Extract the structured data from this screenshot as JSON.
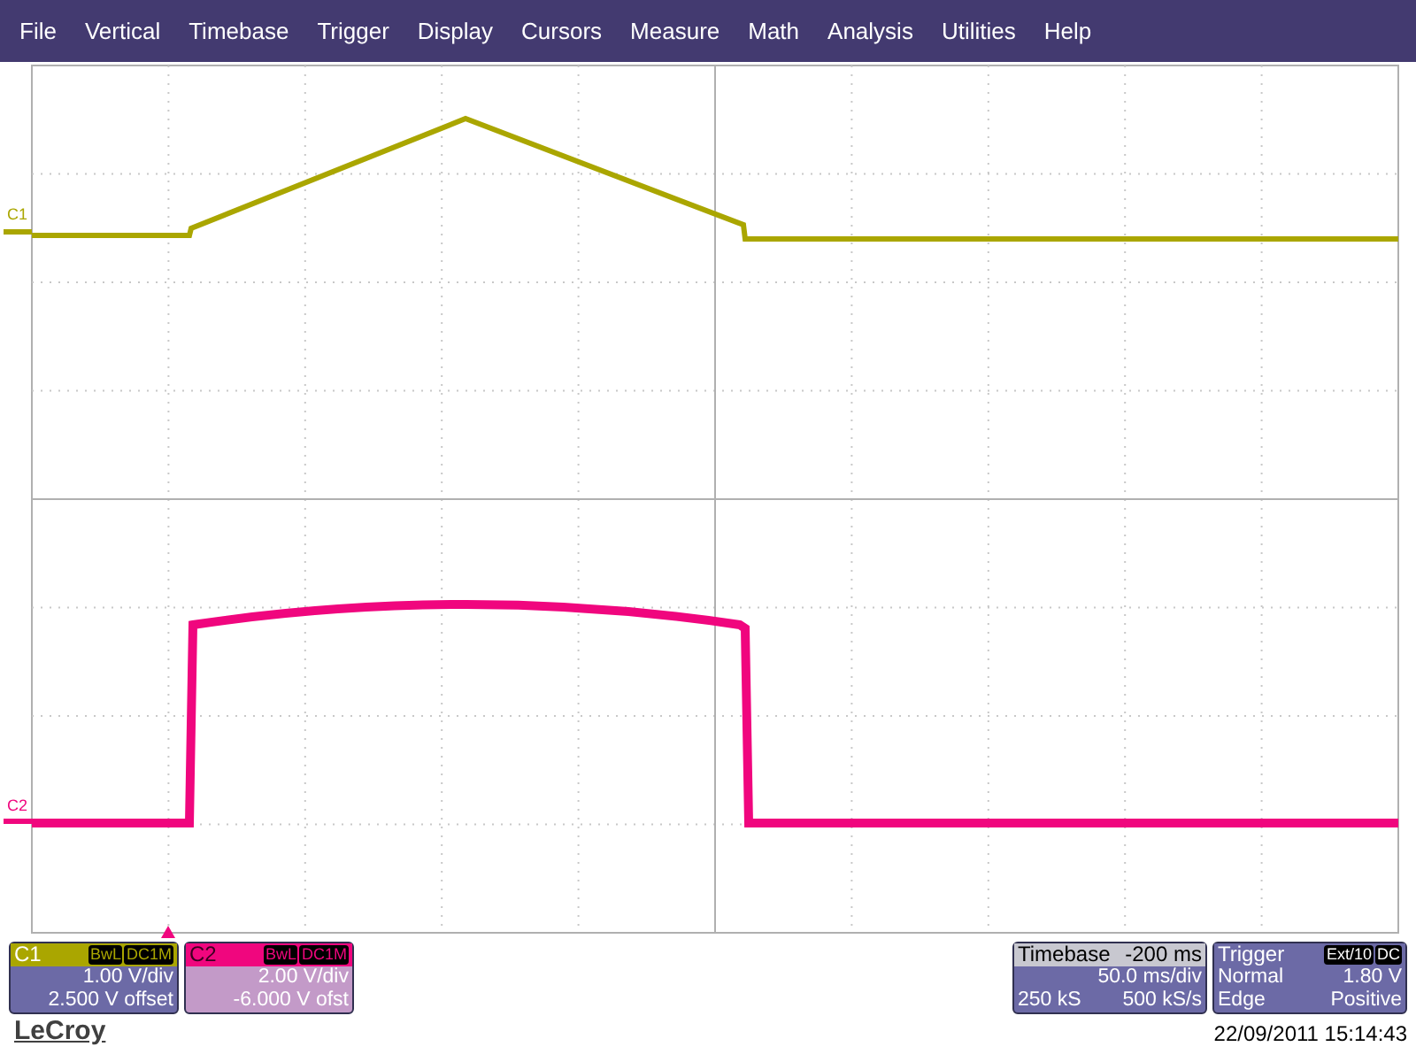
{
  "menu": [
    "File",
    "Vertical",
    "Timebase",
    "Trigger",
    "Display",
    "Cursors",
    "Measure",
    "Math",
    "Analysis",
    "Utilities",
    "Help"
  ],
  "traces": [
    {
      "label": "C1",
      "color": "#aaa600"
    },
    {
      "label": "C2",
      "color": "#f0067e"
    }
  ],
  "channels": [
    {
      "label": "C1",
      "color": "#aaa600",
      "tags": [
        "BwL",
        "DC1M"
      ],
      "lines": [
        "1.00 V/div",
        "2.500 V offset"
      ]
    },
    {
      "label": "C2",
      "color": "#f0067e",
      "tags": [
        "BwL",
        "DC1M"
      ],
      "lines": [
        "2.00 V/div",
        "-6.000 V ofst"
      ]
    }
  ],
  "timebase": {
    "title": "Timebase",
    "value": "-200 ms",
    "rows": [
      [
        "",
        "50.0 ms/div"
      ],
      [
        "250 kS",
        "500 kS/s"
      ]
    ]
  },
  "trigger": {
    "title": "Trigger",
    "tags": [
      "Ext/10",
      "DC"
    ],
    "rows": [
      [
        "Normal",
        "1.80 V"
      ],
      [
        "Edge",
        "Positive"
      ]
    ]
  },
  "brand": "LeCroy",
  "timestamp": "22/09/2011 15:14:43"
}
